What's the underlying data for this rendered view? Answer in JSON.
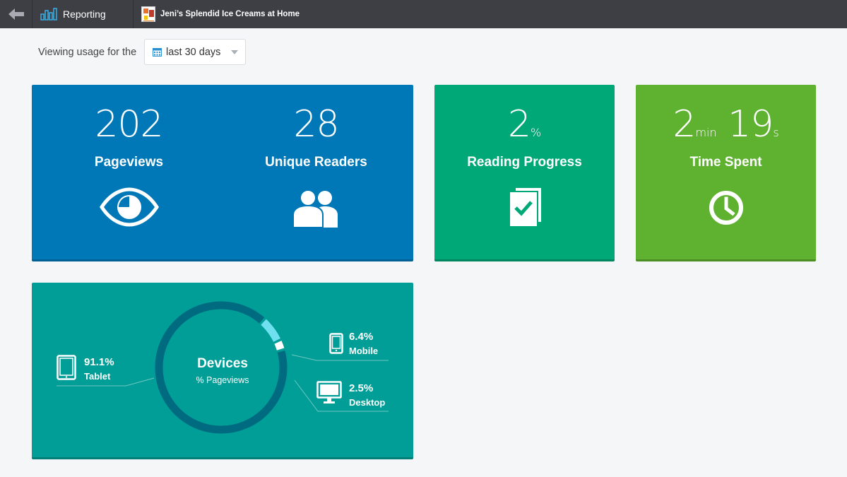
{
  "topbar": {
    "back_icon": "arrow-left-icon",
    "reporting_label": "Reporting",
    "reporting_icon": "bar-chart-icon",
    "book_title": "Jeni’s Splendid Ice Creams at Home"
  },
  "usage": {
    "prefix": "Viewing usage for the",
    "range_value": "last 30 days",
    "range_icon": "calendar-icon"
  },
  "stats": {
    "pageviews": {
      "value": "202",
      "label": "Pageviews",
      "icon": "eye-icon"
    },
    "unique_readers": {
      "value": "28",
      "label": "Unique Readers",
      "icon": "users-icon"
    },
    "reading_progress": {
      "value": "2",
      "unit": "%",
      "label": "Reading Progress",
      "icon": "book-check-icon"
    },
    "time_spent": {
      "minutes": "2",
      "min_unit": "min",
      "seconds": "19",
      "sec_unit": "s",
      "label": "Time Spent",
      "icon": "clock-icon"
    }
  },
  "devices": {
    "title": "Devices",
    "subtitle": "% Pageviews",
    "items": [
      {
        "name": "Tablet",
        "percent_label": "91.1%",
        "icon": "tablet-icon"
      },
      {
        "name": "Mobile",
        "percent_label": "6.4%",
        "icon": "mobile-icon"
      },
      {
        "name": "Desktop",
        "percent_label": "2.5%",
        "icon": "desktop-icon"
      }
    ]
  },
  "chart_data": {
    "type": "pie",
    "categories": [
      "Tablet",
      "Mobile",
      "Desktop"
    ],
    "values": [
      91.1,
      6.4,
      2.5
    ],
    "title": "Devices",
    "subtitle": "% Pageviews",
    "colors": [
      "#006a80",
      "#6fe0f0",
      "#ffffff"
    ]
  },
  "colors": {
    "topbar": "#3d3f45",
    "pageviews_card": "#0078b8",
    "reading_card": "#00a878",
    "time_card": "#5fb130",
    "devices_card": "#009e96"
  }
}
